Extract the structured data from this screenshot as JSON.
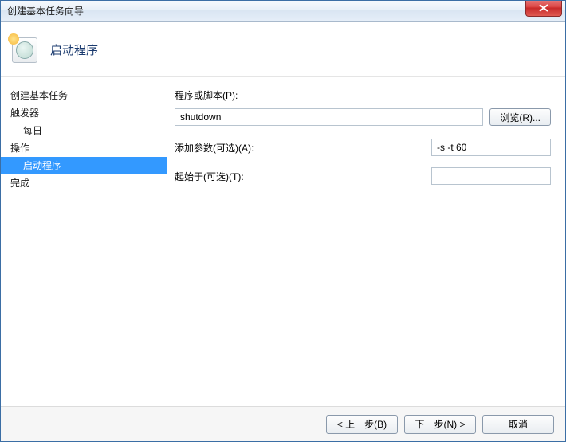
{
  "window": {
    "title": "创建基本任务向导"
  },
  "header": {
    "page_title": "启动程序",
    "icon": "schedule-clock-icon"
  },
  "sidebar": {
    "steps": [
      {
        "label": "创建基本任务",
        "sub": false,
        "active": false
      },
      {
        "label": "触发器",
        "sub": false,
        "active": false
      },
      {
        "label": "每日",
        "sub": true,
        "active": false
      },
      {
        "label": "操作",
        "sub": false,
        "active": false
      },
      {
        "label": "启动程序",
        "sub": true,
        "active": true
      },
      {
        "label": "完成",
        "sub": false,
        "active": false
      }
    ]
  },
  "form": {
    "program_label": "程序或脚本(P):",
    "program_value": "shutdown",
    "browse_label": "浏览(R)...",
    "args_label": "添加参数(可选)(A):",
    "args_value": "-s -t 60",
    "startin_label": "起始于(可选)(T):",
    "startin_value": ""
  },
  "footer": {
    "back_label": "< 上一步(B)",
    "next_label": "下一步(N) >",
    "cancel_label": "取消"
  }
}
